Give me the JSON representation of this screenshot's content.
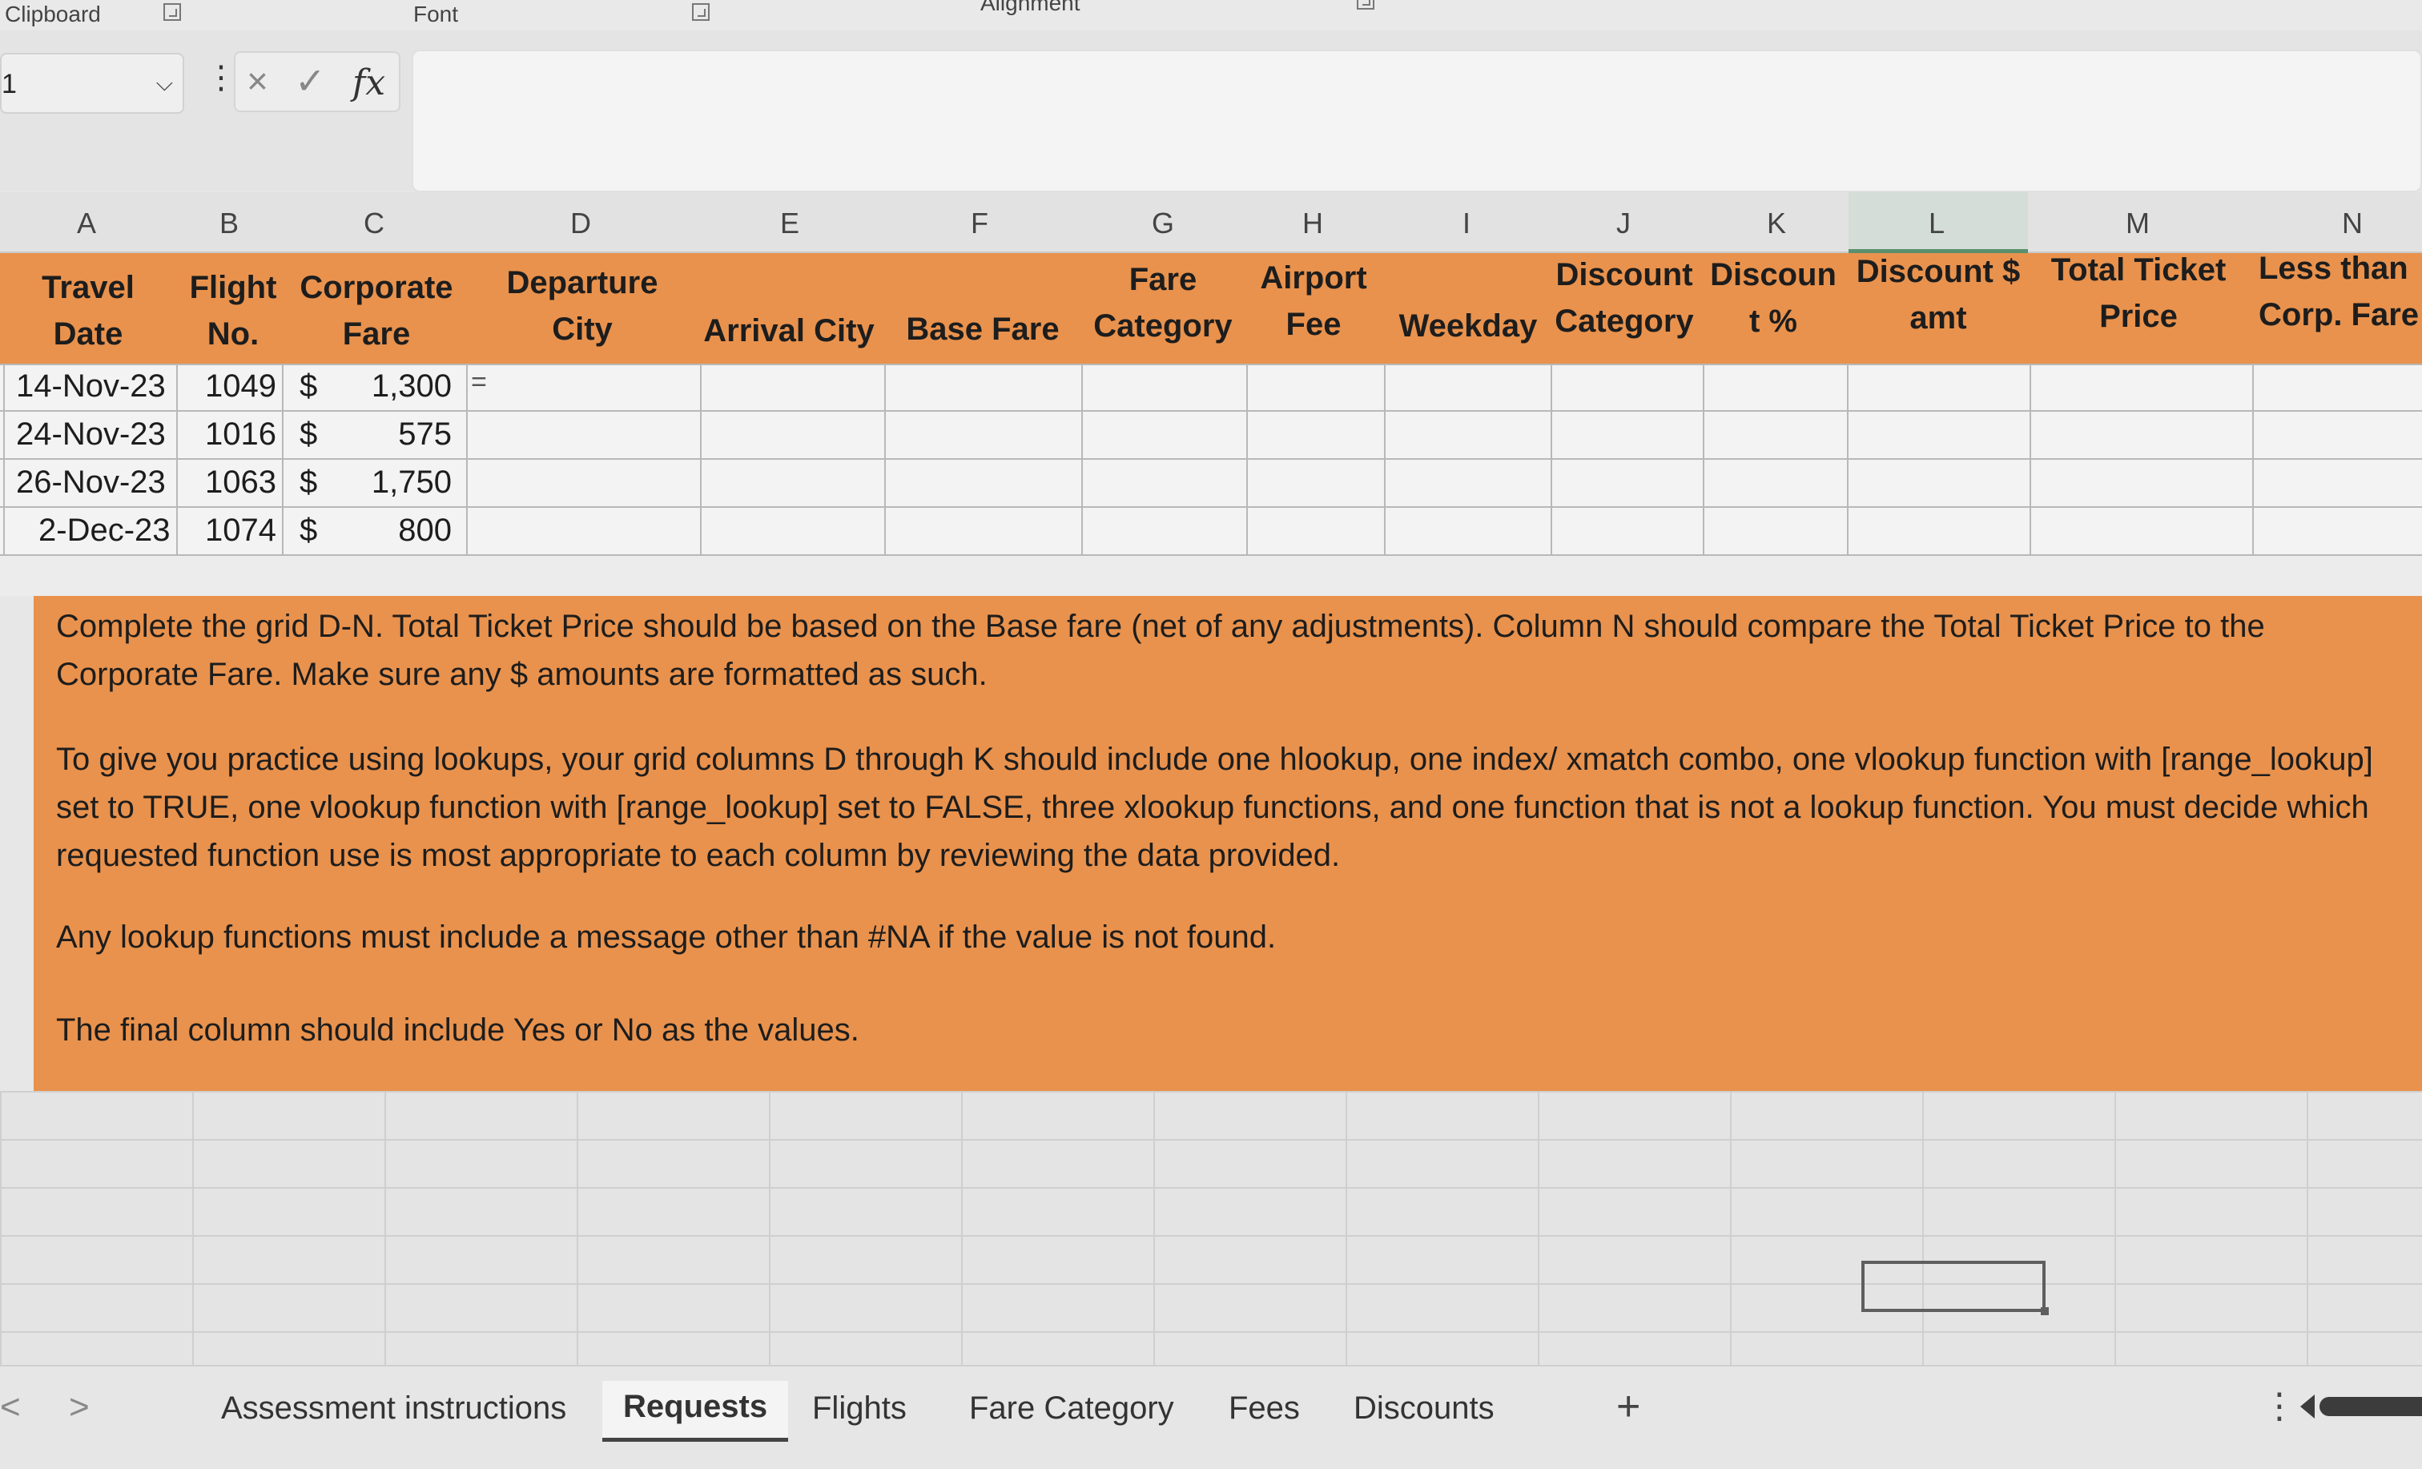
{
  "ribbon": {
    "groups": [
      "Clipboard",
      "Font",
      "Alignment"
    ]
  },
  "formula_bar": {
    "name_box": "1",
    "fx": "fx",
    "cancel": "×",
    "enter": "✓",
    "formula": ""
  },
  "columns": [
    "A",
    "B",
    "C",
    "D",
    "E",
    "F",
    "G",
    "H",
    "I",
    "J",
    "K",
    "L",
    "M",
    "N"
  ],
  "header_row": {
    "a": [
      "Travel",
      "Date"
    ],
    "b": [
      "Flight",
      "No."
    ],
    "c": [
      "Corporate",
      "Fare"
    ],
    "d": [
      "Departure",
      "City"
    ],
    "e": "Arrival City",
    "f": "Base Fare",
    "g": [
      "Fare",
      "Category"
    ],
    "h": [
      "Airport",
      "Fee"
    ],
    "i": "Weekday",
    "j": [
      "Discount",
      "Category"
    ],
    "k": [
      "Discoun",
      "t %"
    ],
    "l": [
      "Discount $",
      "amt"
    ],
    "m": [
      "Total Ticket",
      "Price"
    ],
    "n": [
      "Less than",
      "Corp. Fare"
    ]
  },
  "rows": [
    {
      "date": "14-Nov-23",
      "flight": "1049",
      "currency": "$",
      "fare": "1,300",
      "d": "="
    },
    {
      "date": "24-Nov-23",
      "flight": "1016",
      "currency": "$",
      "fare": "575",
      "d": ""
    },
    {
      "date": "26-Nov-23",
      "flight": "1063",
      "currency": "$",
      "fare": "1,750",
      "d": ""
    },
    {
      "date": "2-Dec-23",
      "flight": "1074",
      "currency": "$",
      "fare": "800",
      "d": ""
    }
  ],
  "instructions": {
    "p1": "Complete the grid D-N.  Total Ticket Price should be based on the Base fare (net of any adjustments). Column N should compare the Total Ticket Price to the Corporate Fare.  Make sure any $ amounts are formatted as such.",
    "p2": "To give you practice using lookups, your grid columns D through K should include one hlookup, one index/ xmatch combo, one vlookup function with [range_lookup] set to TRUE, one vlookup function with [range_lookup] set to FALSE, three xlookup functions, and one function that is not a lookup function. You must decide which requested function use is most appropriate to each column by reviewing the data provided.",
    "p3": "Any lookup functions must include a message other than #NA if the value is not found.",
    "p4": "The final column should include Yes or No as the values."
  },
  "sheet_tabs": {
    "prev": "<",
    "next": ">",
    "tabs": [
      "Assessment instructions",
      "Requests",
      "Flights",
      "Fare Category",
      "Fees",
      "Discounts"
    ],
    "active": "Requests",
    "add": "+",
    "more": "⋮"
  },
  "colors": {
    "header_orange": "#e9924d",
    "grid_line": "#b8b8b8"
  }
}
